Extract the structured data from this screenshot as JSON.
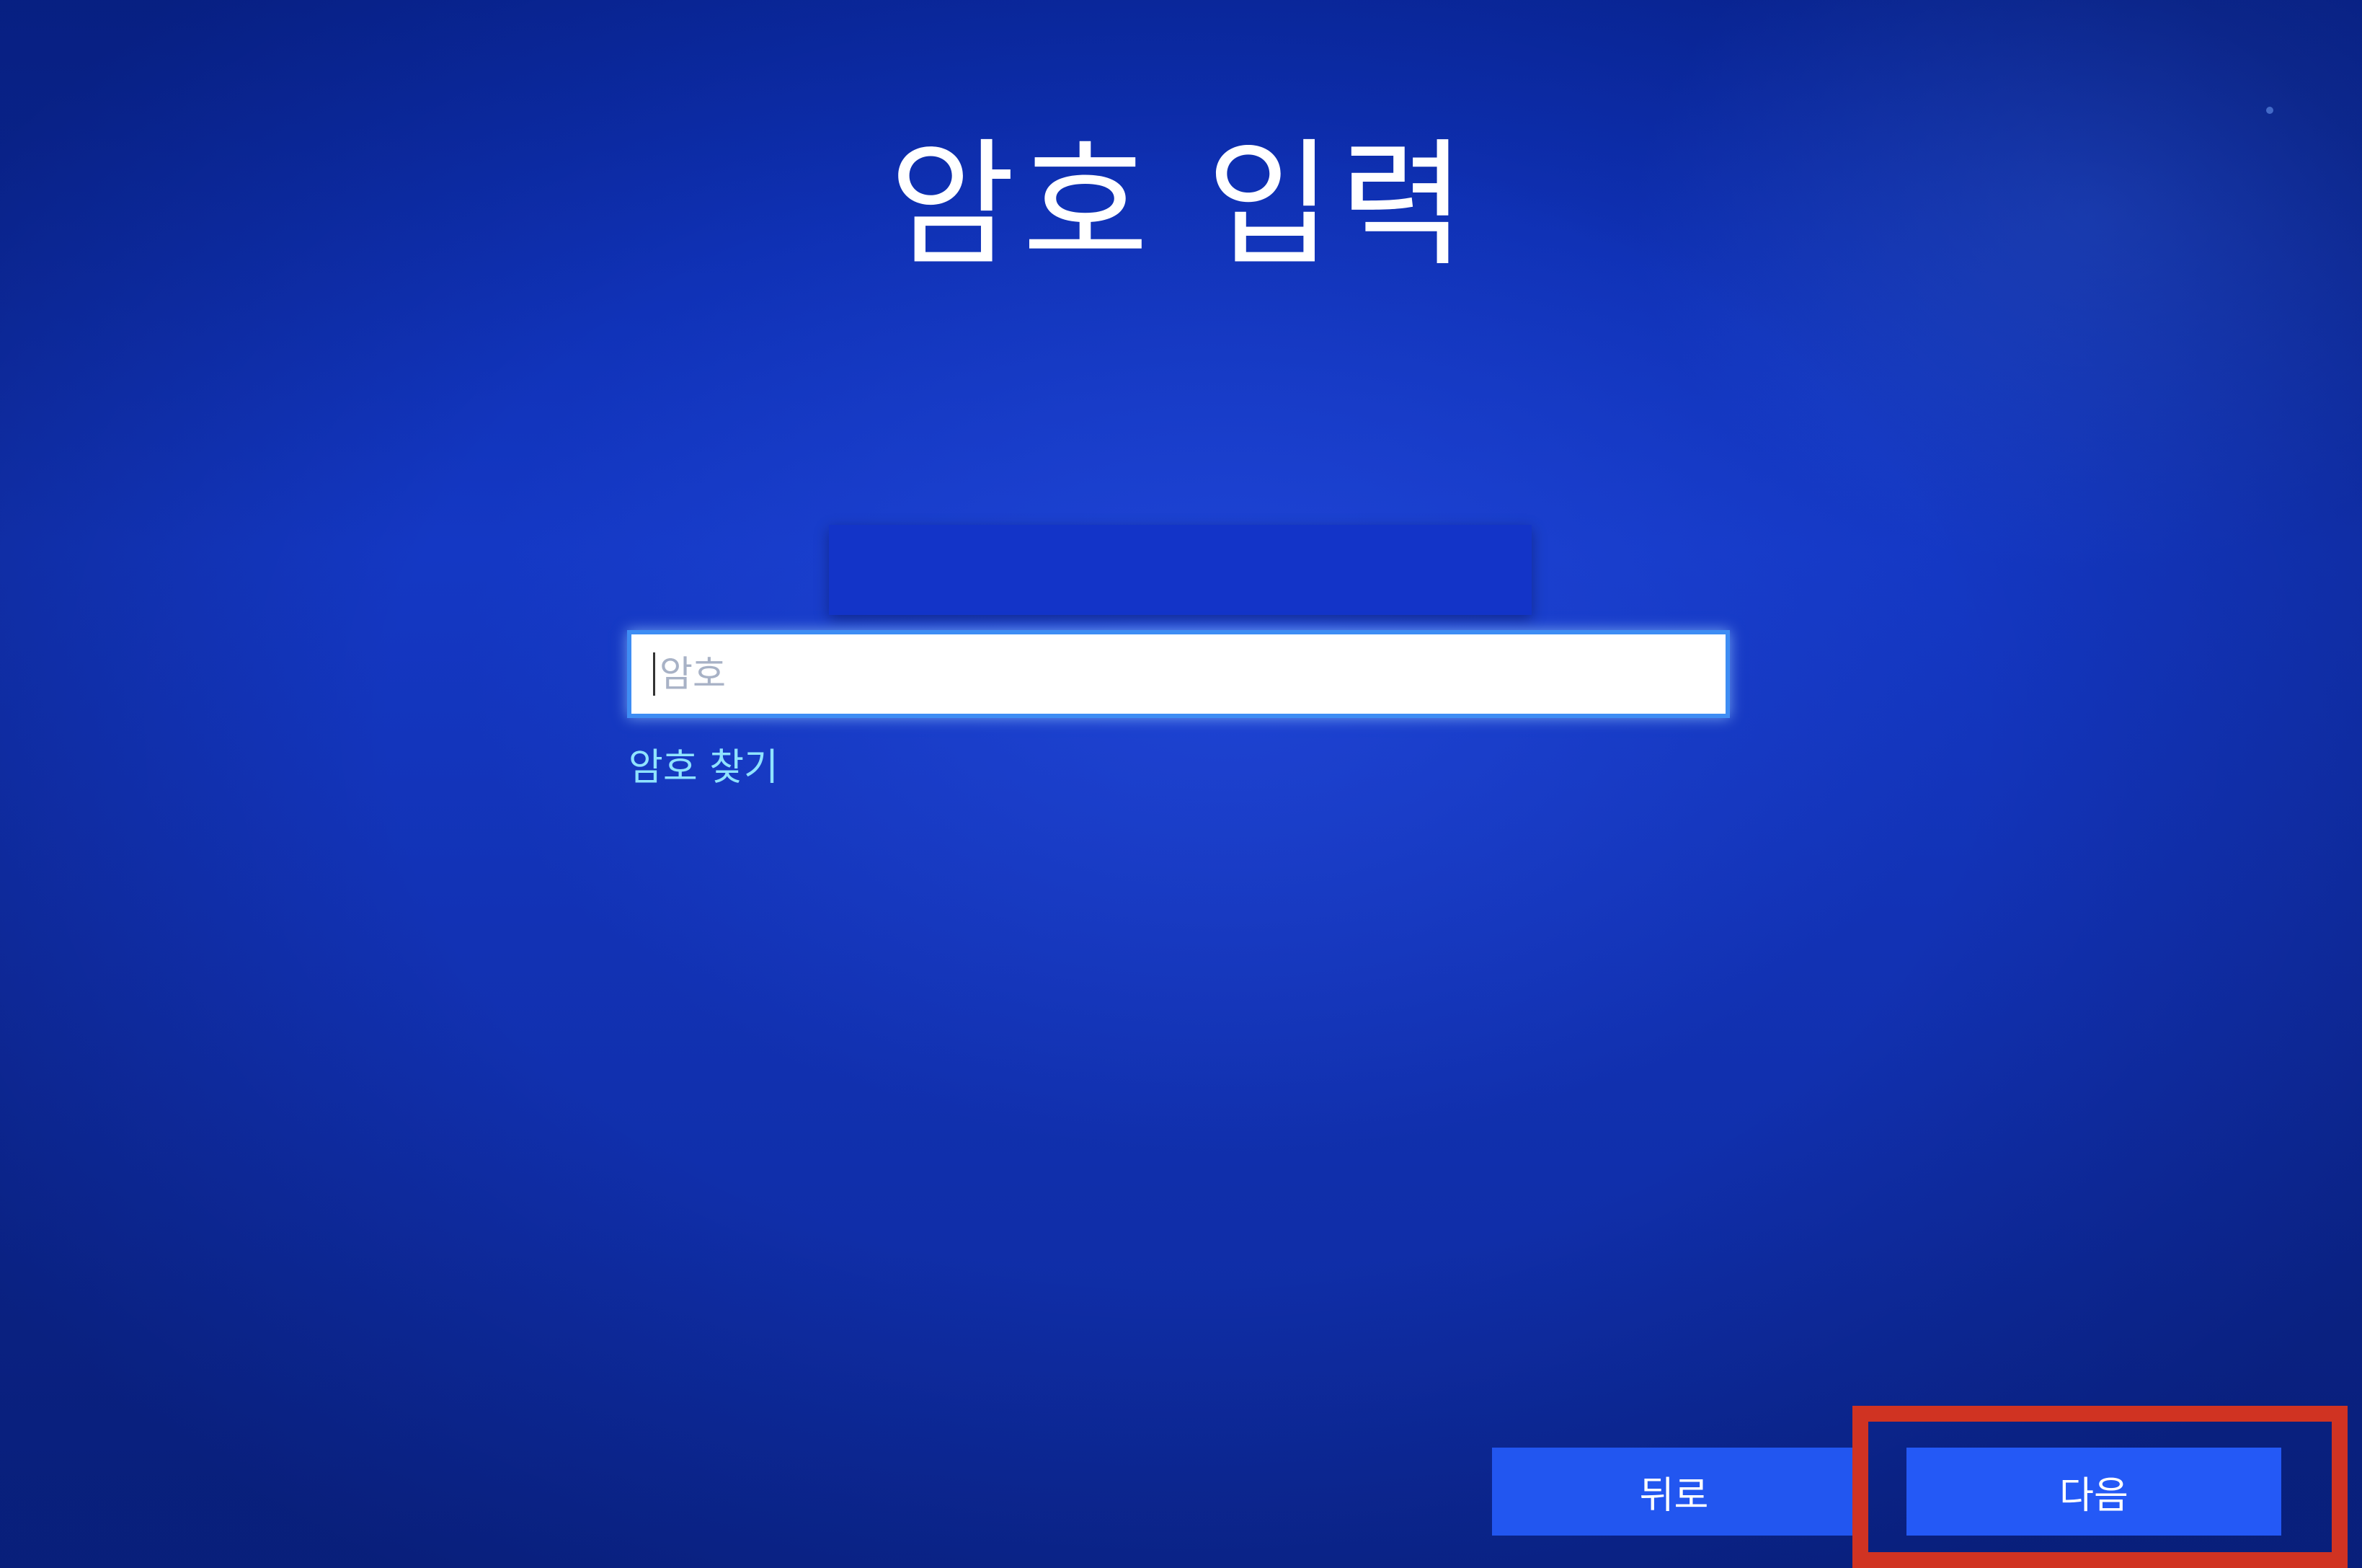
{
  "page": {
    "title": "암호 입력"
  },
  "password": {
    "placeholder": "암호",
    "value": ""
  },
  "links": {
    "forgot_password": "암호 찾기"
  },
  "buttons": {
    "back_label": "뒤로",
    "next_label": "다음"
  },
  "colors": {
    "background": "#1438c4",
    "button": "#2256f0",
    "link": "#8fe3ff",
    "highlight": "#d03322"
  }
}
